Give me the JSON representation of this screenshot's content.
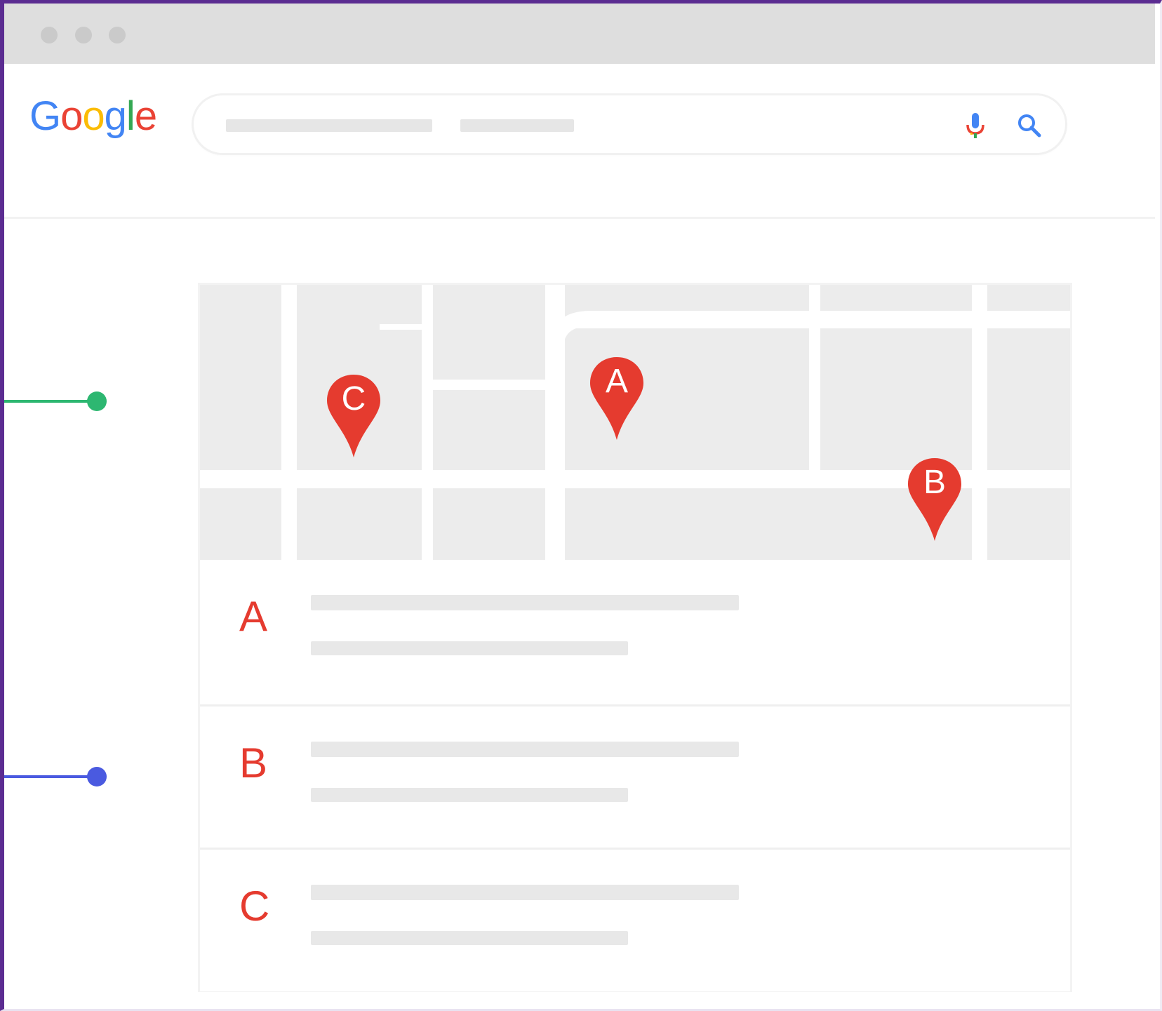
{
  "logo": {
    "letters": [
      "G",
      "o",
      "o",
      "g",
      "l",
      "e"
    ],
    "colors": [
      "#4285F4",
      "#EA4335",
      "#FBBC05",
      "#4285F4",
      "#34A853",
      "#EA4335"
    ]
  },
  "search": {
    "mic_icon": "microphone-icon",
    "search_icon": "magnifier-icon"
  },
  "map": {
    "pins": [
      {
        "label": "A",
        "color": "#E53B2F"
      },
      {
        "label": "B",
        "color": "#E53B2F"
      },
      {
        "label": "C",
        "color": "#E53B2F"
      }
    ]
  },
  "results": [
    {
      "label": "A"
    },
    {
      "label": "B"
    },
    {
      "label": "C"
    }
  ],
  "callouts": {
    "green": "#2DB771",
    "blue": "#4A5AE0"
  },
  "colors": {
    "frame": "#5B2C91",
    "pin": "#E53B2F",
    "placeholder": "#E8E8E8"
  }
}
